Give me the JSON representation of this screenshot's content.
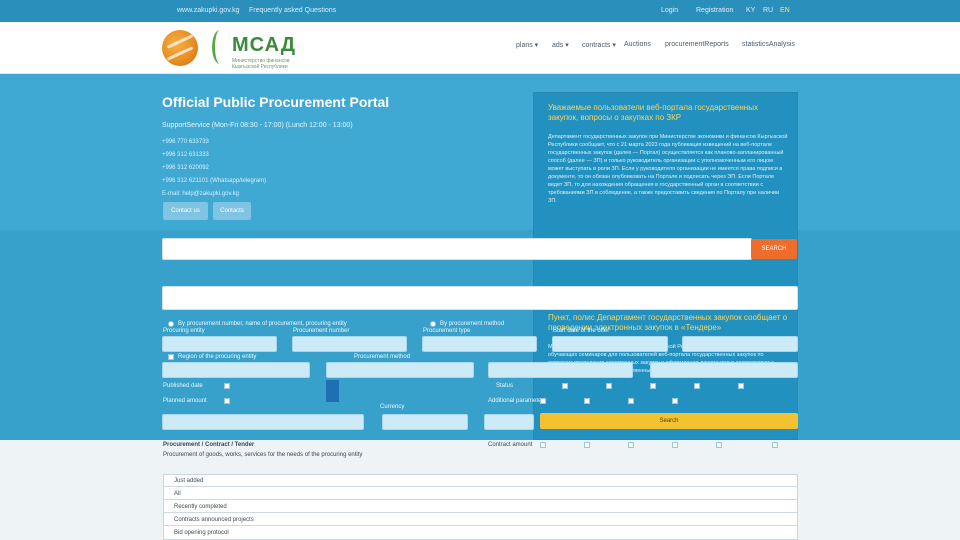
{
  "topbar": {
    "items_left": [
      "www.zakupki.gov.kg",
      "Frequently asked Questions"
    ],
    "login": "Login",
    "register": "Registration",
    "langs": [
      "KY",
      "RU",
      "EN"
    ]
  },
  "header": {
    "logo_text": "МСАД",
    "logo_sub": "Министерство финансов Кыргызской Республики",
    "nav": [
      "plans ▾",
      "ads ▾",
      "contracts ▾",
      "Auctions",
      "procurementReports",
      "statisticsAnalysis"
    ]
  },
  "hero": {
    "title": "Official Public Procurement Portal",
    "support": "SupportService  (Mon-Fri 08:30 - 17:00)  (Lunch 12:00 - 13:00)",
    "phones": [
      "+996 770 633733",
      "+996 312 631333",
      "+996 312 620092",
      "+996 312 621101 (Whatsapp/telegram)",
      "E-mail: help@zakupki.gov.kg"
    ],
    "btn_1": "Contact us",
    "btn_2": "Contacts"
  },
  "news": [
    {
      "title": "Уважаемые пользователи веб-портала государственных закупок, вопросы о закупках по ЗКР",
      "body": "Департамент государственных закупок при Министерстве экономики и финансов Кыргызской Республики сообщает, что с 21 марта 2023 года публикация извещений на веб-портале государственных закупок (далее — Портал) осуществляется как планово-запланированный способ (далее — ЗП) и только руководитель организации с уполномоченным его лицом может выступать в роли ЗП. Если у руководителя организации не имеется права подписи в документе, то он обязан опубликовать на Портале и подписать через ЭП. Если Портале ведет ЗП, то для нахождения обращения в государственный орган в соответствии с требованиями ЗП в соблюдение, а также предоставить сведения по Порталу при наличии ЗП."
    },
    {
      "title": "Пункт, полис Департамент государственных закупок сообщает о проведении электронных закупок в «Тендере»",
      "body": "Министерства экономики и финансов Кыргызской Республики сообщает о проведении обучающих семинаров для пользователей веб-портала государственных закупок по вопросам проведения электронных закупок и оформления документов в соответствии с требованиями закона о государственных закупках."
    }
  ],
  "search": {
    "btn_label": "SEARCH"
  },
  "filters": {
    "radio_1": "By procurement number, name of procurement, procuring entity",
    "radio_2": "By procurement method",
    "label_org": "Procuring entity",
    "label_number": "Procurement number",
    "label_type": "Procurement type",
    "label_start": "Start date of the offer",
    "label_region": "Region of the procuring entity",
    "label_method": "Procurement method",
    "label_date": "Published date",
    "label_status": "Status",
    "label_amount": "Planned amount",
    "label_currency": "Currency",
    "label_extra": "Additional parameters",
    "search_btn": "Search"
  },
  "list": {
    "heading": "Procurement / Contract / Tender",
    "desc": "Procurement of goods, works, services for the needs of the procuring entity",
    "right_label": "Contract amount",
    "tabs": [
      "Just added",
      "All",
      "Recently completed",
      "Contracts announced projects",
      "Bid opening protocol"
    ]
  }
}
